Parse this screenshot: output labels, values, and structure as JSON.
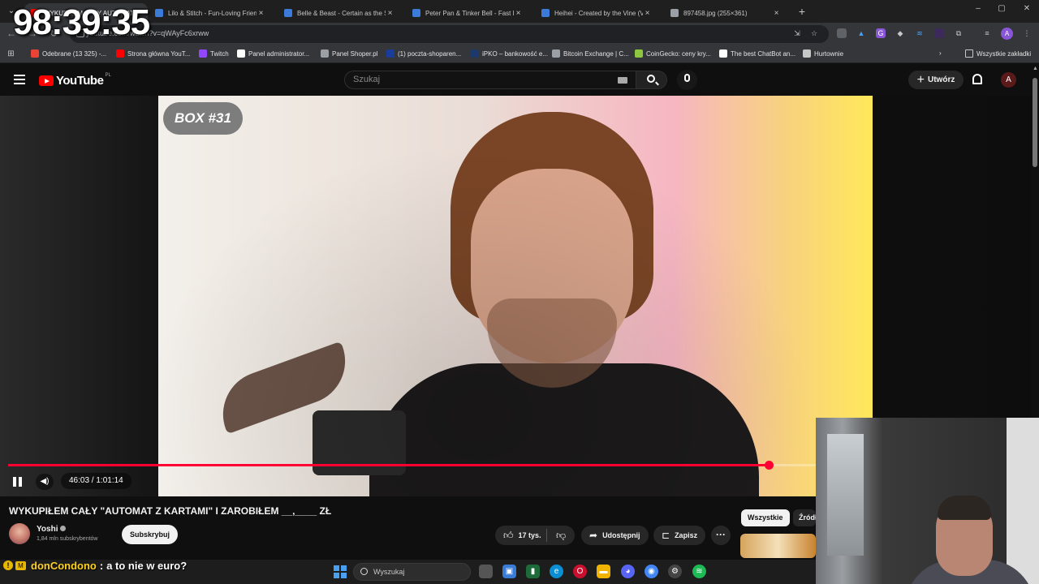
{
  "browser": {
    "tabs": [
      {
        "title": "WYKUPIŁEM CAŁY AUTOMAT",
        "active": true,
        "favicon_color": "#ff0000"
      },
      {
        "title": "Lilo & Stitch - Fun-Loving Frien",
        "active": false,
        "favicon_color": "#3c7bd9"
      },
      {
        "title": "Belle & Beast - Certain as the S",
        "active": false,
        "favicon_color": "#3c7bd9"
      },
      {
        "title": "Peter Pan & Tinker Bell - Fast Fr",
        "active": false,
        "favicon_color": "#3c7bd9"
      },
      {
        "title": "Heihei - Created by the Vine (V",
        "active": false,
        "favicon_color": "#3c7bd9"
      },
      {
        "title": "897458.jpg (255×361)",
        "active": false,
        "favicon_color": "#9aa0a6"
      }
    ],
    "tab_close_glyph": "×",
    "new_tab_glyph": "+",
    "window_controls": {
      "minimize": "–",
      "maximize": "▢",
      "close": "✕"
    },
    "address": {
      "url": "youtube.com/watch?v=qWAyFc6xrww"
    },
    "bookmarks": [
      {
        "label": "Odebrane (13 325) -...",
        "color": "#ea4335"
      },
      {
        "label": "Strona główna YouT...",
        "color": "#ff0000"
      },
      {
        "label": "Twitch",
        "color": "#9146ff"
      },
      {
        "label": "Panel administrator...",
        "color": "#ffffff"
      },
      {
        "label": "Panel Shoper.pl",
        "color": "#9aa0a6"
      },
      {
        "label": "(1) poczta-shoparen...",
        "color": "#1a3d9c"
      },
      {
        "label": "iPKO – bankowość e...",
        "color": "#1b3a6b"
      },
      {
        "label": "Bitcoin Exchange | C...",
        "color": "#9aa0a6"
      },
      {
        "label": "CoinGecko: ceny kry...",
        "color": "#8dc63f"
      },
      {
        "label": "The best ChatBot an...",
        "color": "#ffffff"
      },
      {
        "label": "Hurtownie",
        "color": "#c7c7c7"
      }
    ],
    "bookmarks_overflow": "›",
    "all_bookmarks": "Wszystkie zakładki"
  },
  "youtube": {
    "logo_text": "YouTube",
    "country_code": "PL",
    "search_placeholder": "Szukaj",
    "create_label": "Utwórz",
    "avatar_letter": "A"
  },
  "player": {
    "box_badge": "BOX #31",
    "time_display": "46:03 / 1:01:14",
    "progress_fraction": 0.942,
    "progress_color": "#ff0033"
  },
  "video": {
    "title": "WYKUPIŁEM CAŁY \"AUTOMAT Z KARTAMI\" I ZAROBIŁEM __,____ ZŁ",
    "channel": "Yoshi",
    "subscribers": "1,84 mln subskrybentów",
    "subscribe_label": "Subskrybuj",
    "likes": "17 tys.",
    "share_label": "Udostępnij",
    "save_label": "Zapisz",
    "more_glyph": "···"
  },
  "chips": {
    "active": "Wszystkie",
    "other": "Źródło"
  },
  "chat": {
    "badge1": "!",
    "badge2": "M",
    "user": "donCondono",
    "separator": ":",
    "message": "a to nie w euro?"
  },
  "taskbar": {
    "search_placeholder": "Wyszukaj"
  },
  "overlay_timer": "98:39:35"
}
